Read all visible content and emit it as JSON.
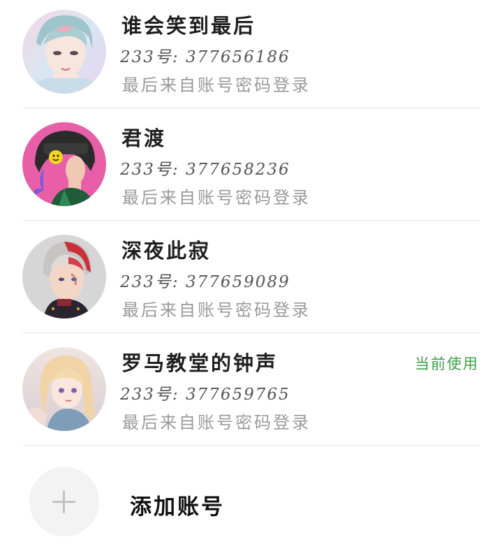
{
  "accounts": [
    {
      "name": "谁会笑到最后",
      "id_line": "233号: 377656186",
      "login_line": "最后来自账号密码登录",
      "is_current": false,
      "avatar_icon": "avatar-pastel-boy"
    },
    {
      "name": "君渡",
      "id_line": "233号: 377658236",
      "login_line": "最后来自账号密码登录",
      "is_current": false,
      "avatar_icon": "avatar-helmet-girl"
    },
    {
      "name": "深夜此寂",
      "id_line": "233号: 377659089",
      "login_line": "最后来自账号密码登录",
      "is_current": false,
      "avatar_icon": "avatar-red-white-hair-boy"
    },
    {
      "name": "罗马教堂的钟声",
      "id_line": "233号: 377659765",
      "login_line": "最后来自账号密码登录",
      "is_current": true,
      "current_label": "当前使用",
      "avatar_icon": "avatar-blonde-girl"
    }
  ],
  "add_account": {
    "label": "添加账号",
    "icon": "plus-icon"
  },
  "colors": {
    "current_badge": "#3fa047",
    "name_text": "#1f1f1f",
    "id_text": "#555555",
    "login_text": "#9a9a9a",
    "divider": "#e8e8e8",
    "add_circle_bg": "#f3f3f3"
  }
}
